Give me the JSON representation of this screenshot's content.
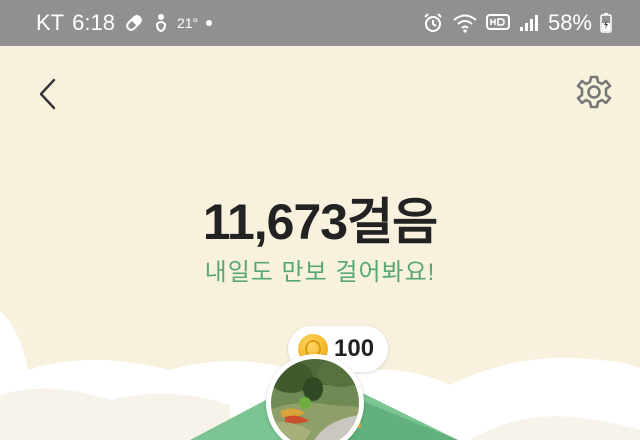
{
  "status_bar": {
    "carrier": "KT",
    "time": "6:18",
    "temperature": "21°",
    "battery": "58%"
  },
  "steps": {
    "count": "11,673걸음",
    "message": "내일도 만보 걸어봐요!"
  },
  "reward": {
    "amount": "100"
  },
  "colors": {
    "background": "#f8f1de",
    "accent_green": "#58a873",
    "status_bar": "#909090"
  },
  "icons": {
    "back": "chevron-left-icon",
    "settings": "gear-icon",
    "coin": "coin-icon"
  }
}
